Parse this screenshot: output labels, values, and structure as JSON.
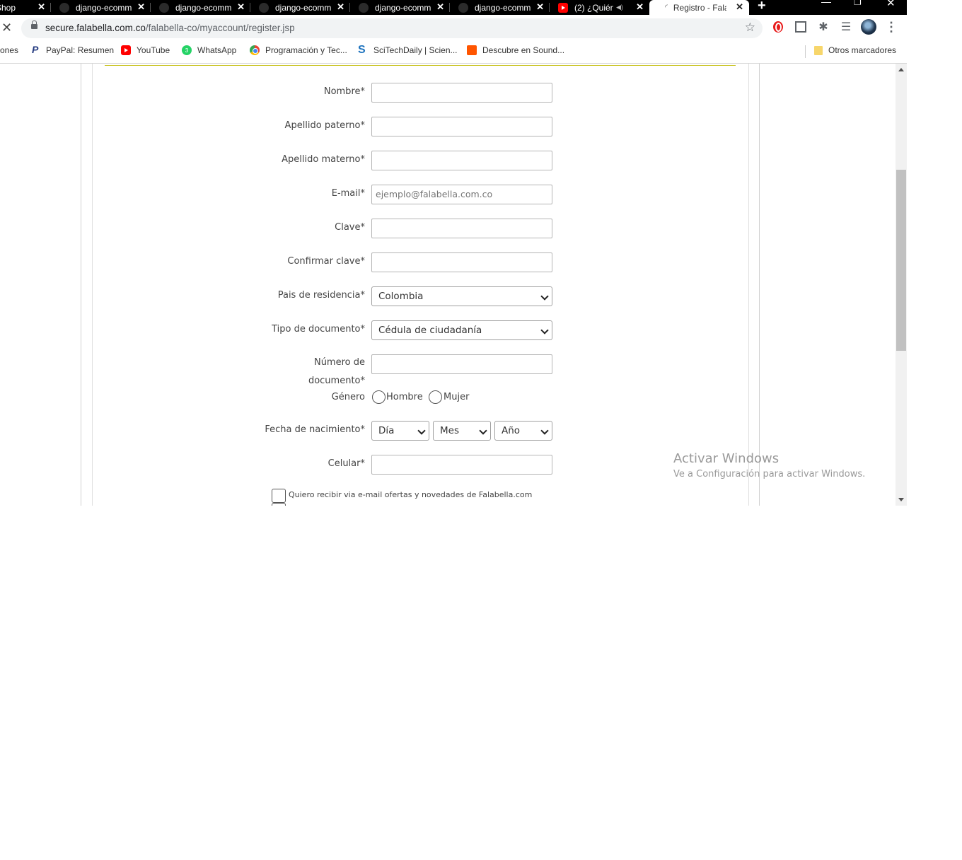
{
  "tabs": [
    {
      "label": "Shop",
      "icon": "cart-icon",
      "active": false
    },
    {
      "label": "django-ecomm",
      "icon": "github-icon",
      "active": false
    },
    {
      "label": "django-ecomm",
      "icon": "github-icon",
      "active": false
    },
    {
      "label": "django-ecomm",
      "icon": "github-icon",
      "active": false
    },
    {
      "label": "django-ecomm",
      "icon": "github-icon",
      "active": false
    },
    {
      "label": "django-ecomm",
      "icon": "github-icon",
      "active": false
    },
    {
      "label": "(2) ¿Quién",
      "icon": "youtube-icon",
      "active": false
    },
    {
      "label": "Registro - Fala",
      "icon": "falabella-icon",
      "active": true
    }
  ],
  "address_bar": {
    "host": "secure.falabella.com.co",
    "path": "/falabella-co/myaccount/register.jsp"
  },
  "bookmarks": [
    {
      "label": "ones",
      "icon": "none"
    },
    {
      "label": "PayPal: Resumen",
      "icon": "paypal-icon"
    },
    {
      "label": "YouTube",
      "icon": "youtube-icon"
    },
    {
      "label": "WhatsApp",
      "icon": "whatsapp-icon",
      "badge": "3"
    },
    {
      "label": "Programación y Tec...",
      "icon": "chrome-icon"
    },
    {
      "label": "SciTechDaily | Scien...",
      "icon": "scitechdaily-icon"
    },
    {
      "label": "Descubre en Sound...",
      "icon": "soundcloud-icon"
    },
    {
      "label": "Otros marcadores",
      "icon": "folder-icon"
    }
  ],
  "form": {
    "fields": {
      "nombre": {
        "label": "Nombre*",
        "value": ""
      },
      "apellido_paterno": {
        "label": "Apellido paterno*",
        "value": ""
      },
      "apellido_materno": {
        "label": "Apellido materno*",
        "value": ""
      },
      "email": {
        "label": "E-mail*",
        "placeholder": "ejemplo@falabella.com.co"
      },
      "clave": {
        "label": "Clave*",
        "value": ""
      },
      "confirmar_clave": {
        "label": "Confirmar clave*",
        "value": ""
      },
      "pais": {
        "label": "Pais de residencia*",
        "selected": "Colombia"
      },
      "tipo_documento": {
        "label": "Tipo de documento*",
        "selected": "Cédula de ciudadanía"
      },
      "numero_documento": {
        "label": "Número de documento*",
        "value": ""
      },
      "genero": {
        "label": "Género",
        "options": [
          "Hombre",
          "Mujer"
        ]
      },
      "fecha_nacimiento": {
        "label": "Fecha de nacimiento*",
        "dia": "Día",
        "mes": "Mes",
        "anio": "Año"
      },
      "celular": {
        "label": "Celular*",
        "value": ""
      }
    },
    "newsletter_label": "Quiero recibir via e-mail ofertas y novedades de Falabella.com"
  },
  "watermark": {
    "title": "Activar Windows",
    "subtitle": "Ve a Configuración para activar Windows."
  }
}
